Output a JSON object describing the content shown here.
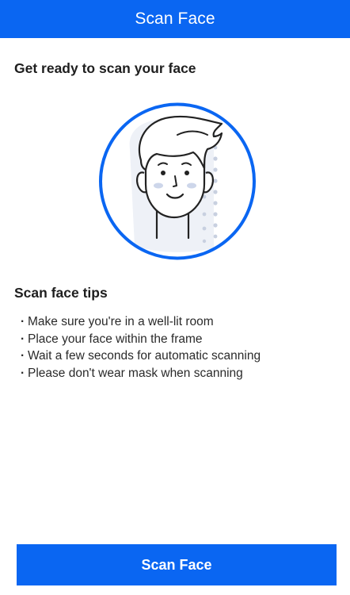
{
  "header": {
    "title": "Scan Face"
  },
  "intro": {
    "heading": "Get ready to scan your face"
  },
  "illustration": {
    "icon": "face-scan-icon",
    "ring_color": "#0a66f2"
  },
  "tips": {
    "heading": "Scan face tips",
    "bullet": "·",
    "items": [
      "Make sure you're in a well-lit room",
      "Place your face within the frame",
      "Wait a few seconds for automatic scanning",
      "Please don't wear mask when scanning"
    ]
  },
  "action": {
    "scan_label": "Scan Face"
  },
  "colors": {
    "brand": "#0a66f2",
    "background": "#ffffff",
    "text": "#1e1e1e"
  }
}
